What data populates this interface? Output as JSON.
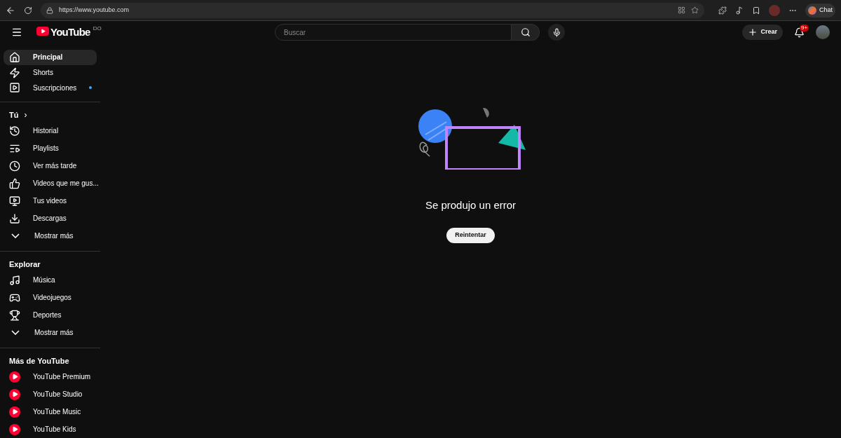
{
  "browser": {
    "url": "https://www.youtube.com",
    "chat_label": "Chat"
  },
  "header": {
    "logo_text": "YouTube",
    "country_code": "DO",
    "search": {
      "placeholder": "Buscar"
    },
    "create_label": "Crear",
    "notification_count": "9+"
  },
  "sidebar": {
    "main": [
      {
        "label": "Principal",
        "selected": true,
        "dot": false
      },
      {
        "label": "Shorts",
        "selected": false,
        "dot": false
      },
      {
        "label": "Suscripciones",
        "selected": false,
        "dot": true
      }
    ],
    "sections": [
      {
        "title": "Tú",
        "chevron": "›",
        "items": [
          {
            "label": "Historial",
            "selected": false
          },
          {
            "label": "Playlists",
            "selected": false
          },
          {
            "label": "Ver más tarde",
            "selected": false
          },
          {
            "label": "Videos que me gus...",
            "selected": false
          },
          {
            "label": "Tus videos",
            "selected": false
          },
          {
            "label": "Descargas",
            "selected": false
          },
          {
            "label": "Mostrar más",
            "selected": false
          }
        ]
      },
      {
        "title": "Explorar",
        "items": [
          {
            "label": "Música",
            "selected": false
          },
          {
            "label": "Videojuegos",
            "selected": false
          },
          {
            "label": "Deportes",
            "selected": false
          },
          {
            "label": "Mostrar más",
            "selected": false
          }
        ]
      },
      {
        "title": "Más de YouTube",
        "items": [
          {
            "label": "YouTube Premium",
            "selected": false
          },
          {
            "label": "YouTube Studio",
            "selected": false
          },
          {
            "label": "YouTube Music",
            "selected": false
          },
          {
            "label": "YouTube Kids",
            "selected": false
          }
        ]
      }
    ]
  },
  "error": {
    "message": "Se produjo un error",
    "retry_label": "Reintentar"
  }
}
